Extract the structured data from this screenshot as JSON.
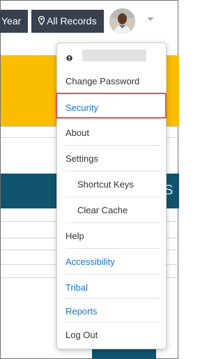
{
  "topbar": {
    "year_label": "Year",
    "records_label": "All Records",
    "records_icon": "map-pin-icon",
    "avatar_icon": "user-avatar",
    "caret_icon": "chevron-down-icon"
  },
  "background": {
    "band_text": "S",
    "accent_yellow": "#fbbd00",
    "accent_blue": "#11546f"
  },
  "menu": {
    "user_icon": "user-icon",
    "items": [
      {
        "label": "Change Password"
      },
      {
        "label": "Security",
        "highlighted": true
      },
      {
        "label": "About"
      },
      {
        "label": "Settings"
      },
      {
        "label": "Shortcut Keys"
      },
      {
        "label": "Clear Cache"
      },
      {
        "label": "Help"
      },
      {
        "label": "Accessibility"
      },
      {
        "label": "Tribal"
      },
      {
        "label": "Reports"
      },
      {
        "label": "Log Out"
      }
    ],
    "link_color": "#1a73c4",
    "highlight_color": "#e34c53"
  }
}
